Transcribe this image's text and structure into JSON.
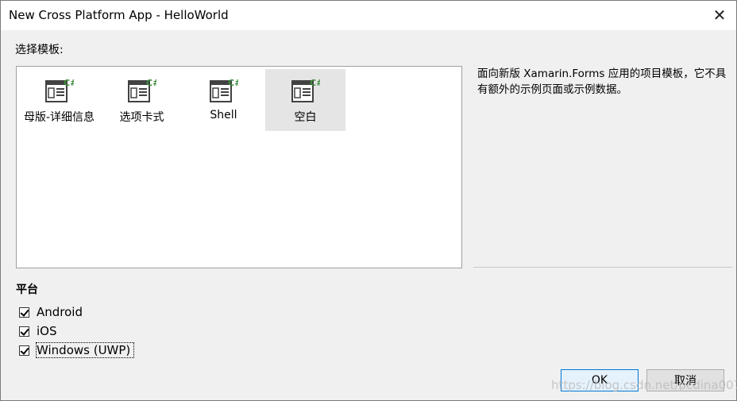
{
  "window": {
    "title": "New Cross Platform App - HelloWorld",
    "close_glyph": "✕"
  },
  "templates": {
    "label": "选择模板:",
    "items": [
      {
        "label": "母版-详细信息",
        "icon": "csharp-template-icon"
      },
      {
        "label": "选项卡式",
        "icon": "csharp-template-icon"
      },
      {
        "label": "Shell",
        "icon": "csharp-template-icon"
      },
      {
        "label": "空白",
        "icon": "csharp-template-icon",
        "selected": true
      }
    ]
  },
  "description": "面向新版 Xamarin.Forms 应用的项目模板，它不具有额外的示例页面或示例数据。",
  "platforms": {
    "label": "平台",
    "items": [
      {
        "label": "Android",
        "checked": true
      },
      {
        "label": "iOS",
        "checked": true
      },
      {
        "label": "Windows (UWP)",
        "checked": true
      }
    ]
  },
  "buttons": {
    "ok": "OK",
    "cancel": "取消"
  },
  "watermark": "https://blog.csdn.net/pcdina007",
  "colors": {
    "icon_green": "#3c8c3c",
    "icon_dark": "#424242",
    "selected_bg": "#e5e5e5",
    "focus_blue": "#0078d7"
  }
}
